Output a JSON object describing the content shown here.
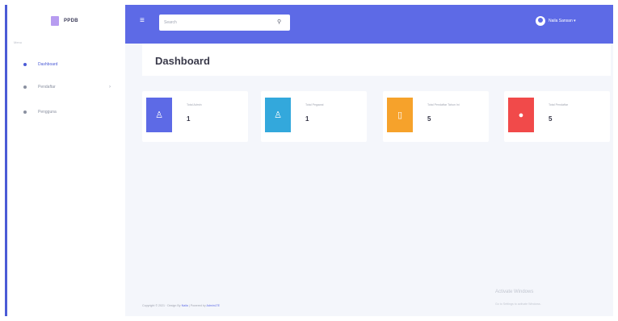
{
  "brand": {
    "name": "PPDB"
  },
  "sidebar": {
    "caption": "Menu",
    "items": [
      {
        "label": "Dashboard",
        "active": true
      },
      {
        "label": "Pendaftar",
        "has_chevron": true,
        "chevron": "›"
      },
      {
        "label": "Pengguna"
      }
    ]
  },
  "header": {
    "menu_icon": "≡",
    "search": {
      "placeholder": "Search",
      "icon": "⚲"
    },
    "user_name": "Naila Sansan ▾"
  },
  "main": {
    "title": "Dashboard"
  },
  "stats": [
    {
      "label": "Total Admin",
      "value": "1",
      "color": "#5d6ae6",
      "icon": "♙"
    },
    {
      "label": "Total Pegawai",
      "value": "1",
      "color": "#33a8dc",
      "icon": "♙"
    },
    {
      "label": "Total Pendaftar Tahun Ini",
      "value": "5",
      "color": "#f6a22b",
      "icon": "▯"
    },
    {
      "label": "Total Pendaftar",
      "value": "5",
      "color": "#f14a4a",
      "icon": "●"
    }
  ],
  "footer": {
    "text": "Copyright © 2021 · Design By",
    "design_link": "Naila",
    "powered_text": " | Powered by",
    "powered_link": "AdminLTE"
  },
  "watermark": {
    "title": "Activate Windows",
    "sub": "Go to Settings to activate Windows."
  },
  "colors": {
    "accent": "#5d6ae6",
    "sidebar_bg": "#ffffff",
    "page_bg": "#f4f6fb"
  }
}
